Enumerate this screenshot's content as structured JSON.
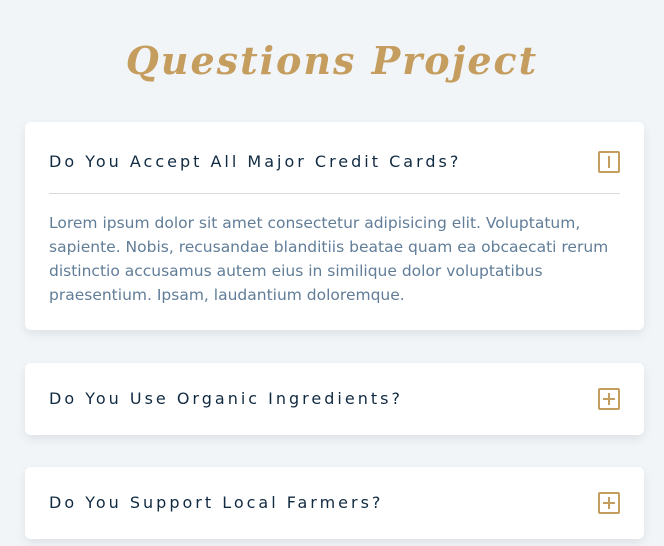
{
  "page": {
    "title": "Questions Project"
  },
  "questions": [
    {
      "title": "Do You Accept All Major Credit Cards?",
      "expanded": true,
      "toggle_icon": "minus-icon",
      "answer": "Lorem ipsum dolor sit amet consectetur adipisicing elit. Voluptatum, sapiente. Nobis, recusandae blanditiis beatae quam ea obcaecati rerum distinctio accusamus autem eius in similique dolor voluptatibus praesentium. Ipsam, laudantium doloremque."
    },
    {
      "title": "Do You Use Organic Ingredients?",
      "expanded": false,
      "toggle_icon": "plus-icon"
    },
    {
      "title": "Do You Support Local Farmers?",
      "expanded": false,
      "toggle_icon": "plus-icon"
    }
  ],
  "colors": {
    "background": "#f1f5f8",
    "accent": "#c59d5f",
    "heading": "#102a42",
    "body_text": "#617d98",
    "card": "#ffffff"
  }
}
